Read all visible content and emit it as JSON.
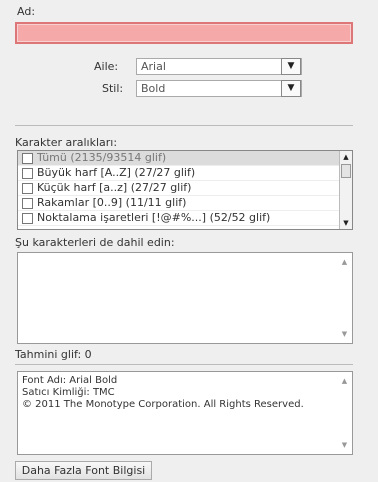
{
  "name_field": {
    "label": "Ad:",
    "value": ""
  },
  "font_family": {
    "label": "Aile:",
    "value": "Arial"
  },
  "font_style": {
    "label": "Stil:",
    "value": "Bold"
  },
  "character_ranges": {
    "label": "Karakter aralıkları:",
    "items": [
      {
        "label": "Tümü  (2135/93514 glif)",
        "checked": false,
        "selected": true
      },
      {
        "label": "Büyük harf [A..Z]  (27/27 glif)",
        "checked": false,
        "selected": false
      },
      {
        "label": "Küçük harf [a..z]  (27/27 glif)",
        "checked": false,
        "selected": false
      },
      {
        "label": "Rakamlar [0..9]  (11/11 glif)",
        "checked": false,
        "selected": false
      },
      {
        "label": "Noktalama işaretleri [!@#%...]  (52/52 glif)",
        "checked": false,
        "selected": false
      }
    ]
  },
  "include_characters": {
    "label": "Şu karakterleri de dahil edin:",
    "value": ""
  },
  "estimated_glyphs": {
    "label": "Tahmini glif: 0"
  },
  "font_info": {
    "lines": [
      "Font Adı: Arial Bold",
      "Satıcı Kimliği: TMC",
      "© 2011 The Monotype Corporation. All Rights Reserved."
    ]
  },
  "buttons": {
    "more_font_info": "Daha Fazla Font Bilgisi"
  }
}
